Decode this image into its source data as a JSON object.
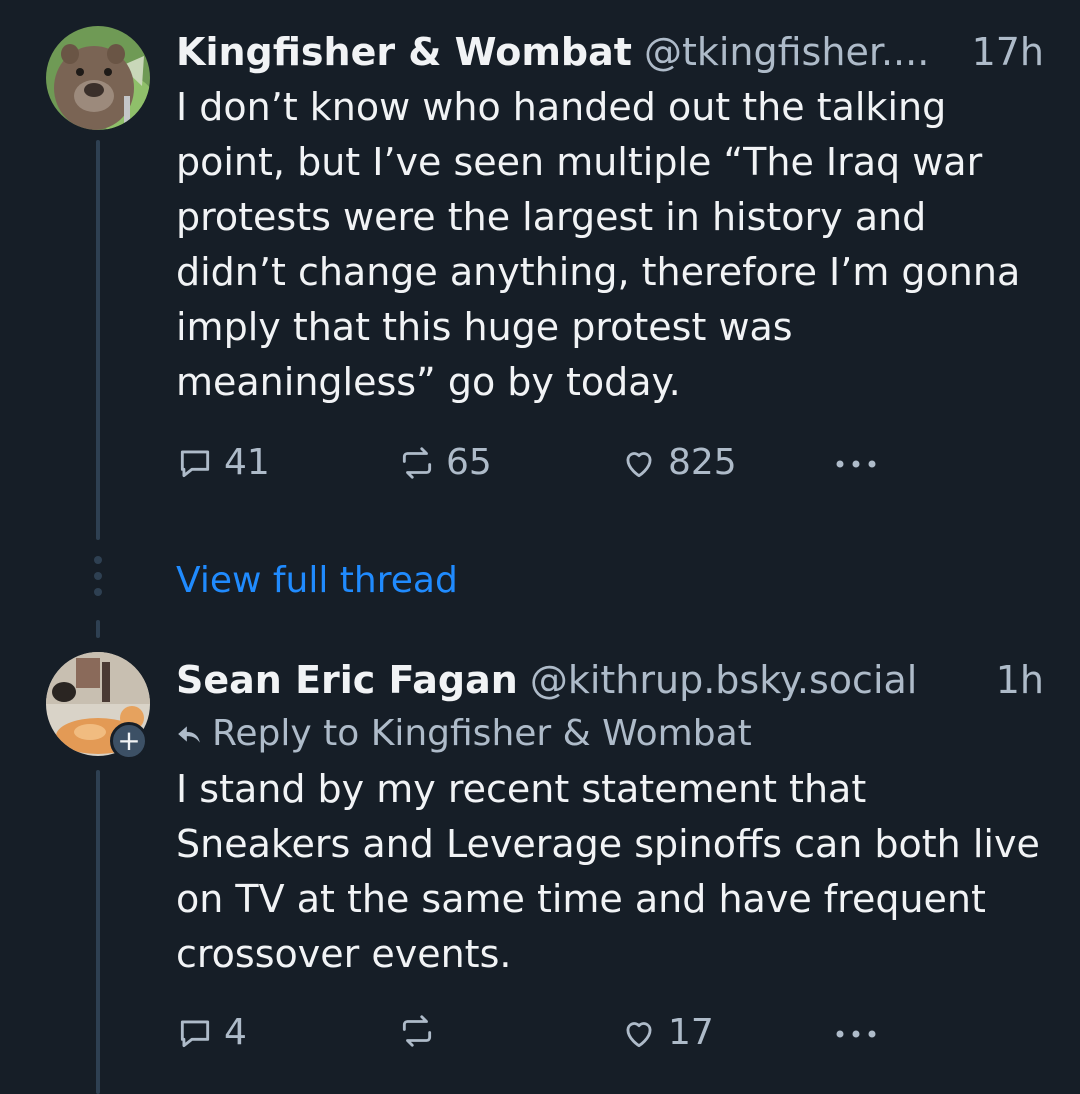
{
  "post1": {
    "author": "Kingfisher & Wombat",
    "handle": "@tkingfisher....",
    "time": "17h",
    "text": "I don’t know who handed out the talking point, but I’ve seen multiple “The Iraq war protests were the largest in history and didn’t change anything, therefore I’m gonna imply that this huge protest was meaningless” go by today.",
    "replies": "41",
    "reposts": "65",
    "likes": "825"
  },
  "view_thread": "View full thread",
  "post2": {
    "author": "Sean Eric Fagan",
    "handle": "@kithrup.bsky.social",
    "time": "1h",
    "reply_to": "Reply to Kingfisher & Wombat",
    "text": "I stand by my recent statement that Sneakers and Leverage spinoffs can both live on TV at the same time and have frequent crossover events.",
    "replies": "4",
    "reposts": "",
    "likes": "17",
    "follow_badge": "+"
  },
  "colors": {
    "background": "#161e27",
    "text": "#f1f3f5",
    "muted": "#aebbc9",
    "link": "#208bfe",
    "thread_line": "#2e4052"
  },
  "icons": [
    "wombat-avatar",
    "cat-avatar",
    "reply-icon",
    "repost-icon",
    "like-icon",
    "more-icon",
    "reply-arrow-icon"
  ]
}
